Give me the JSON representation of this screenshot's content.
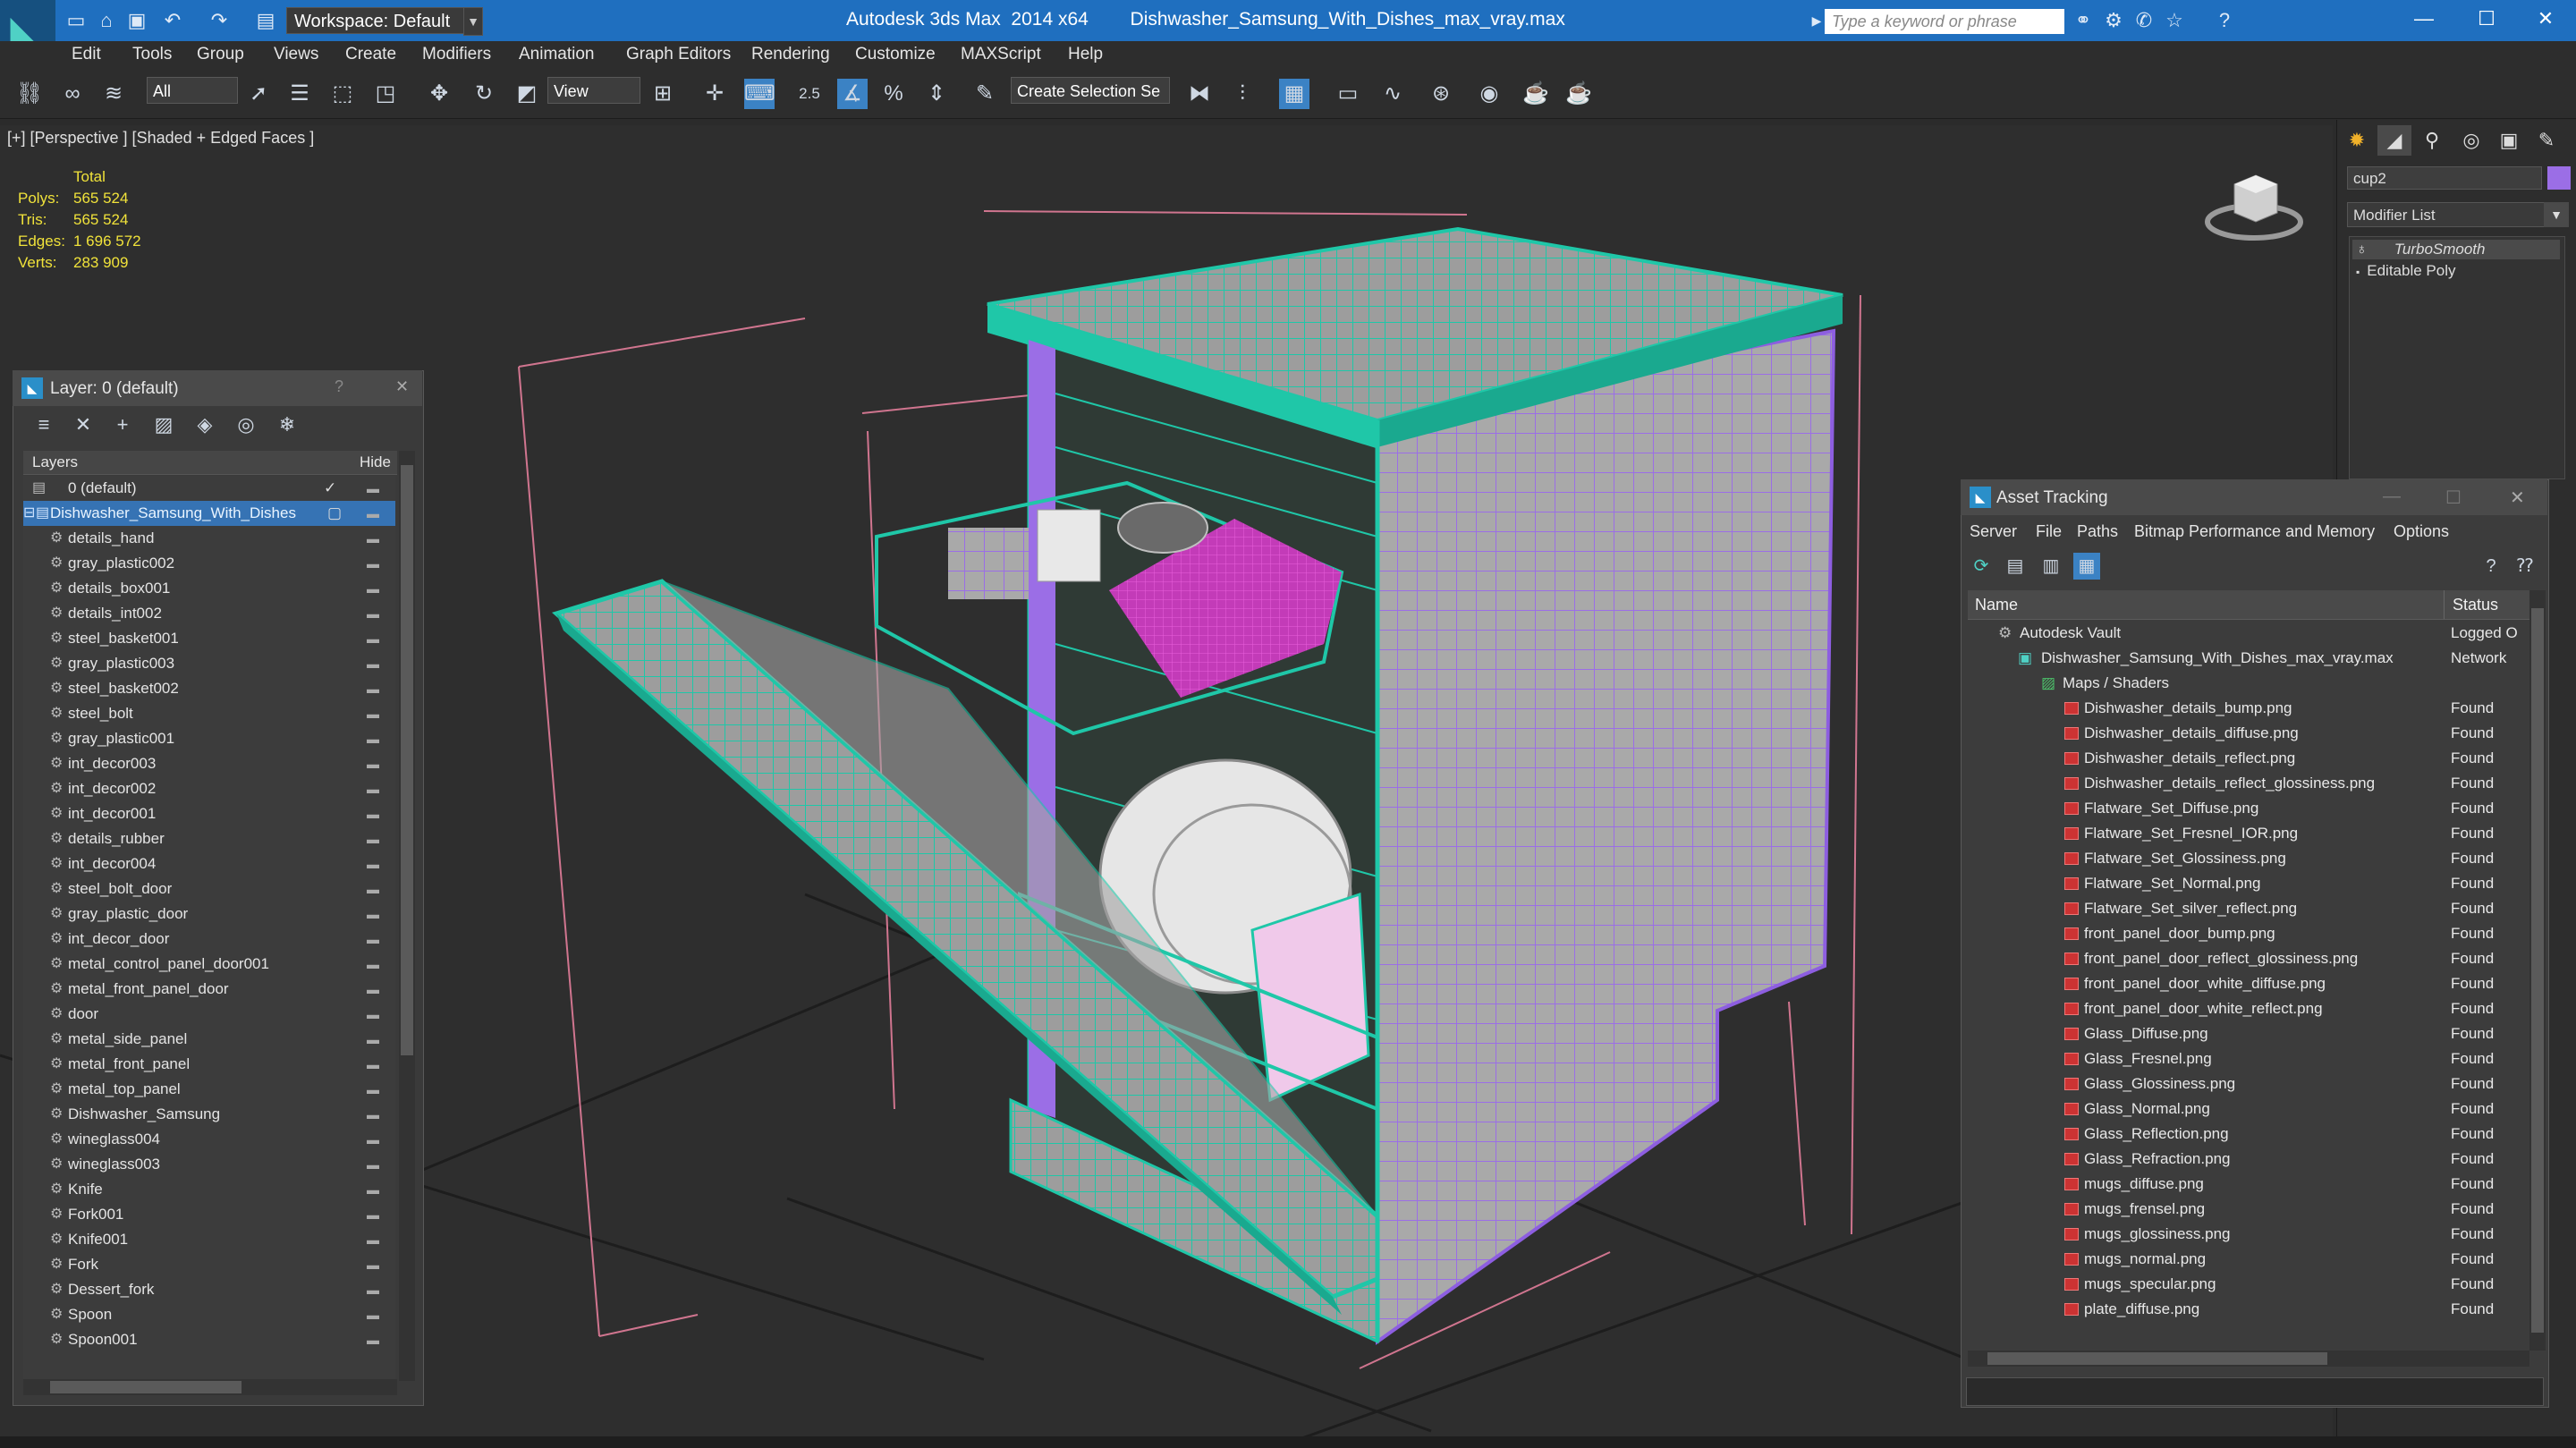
{
  "titlebar": {
    "workspace": "Workspace: Default",
    "app": "Autodesk 3ds Max  2014 x64",
    "file": "Dishwasher_Samsung_With_Dishes_max_vray.max",
    "search_placeholder": "Type a keyword or phrase",
    "minimize": "—",
    "maximize": "☐",
    "close": "✕"
  },
  "menu": [
    "Edit",
    "Tools",
    "Group",
    "Views",
    "Create",
    "Modifiers",
    "Animation",
    "Graph Editors",
    "Rendering",
    "Customize",
    "MAXScript",
    "Help"
  ],
  "toolbar": {
    "filter": "All",
    "refcoord": "View",
    "selset": "Create Selection Se",
    "snap_angle": "2.5"
  },
  "viewport": {
    "label": "[+] [Perspective ] [Shaded + Edged Faces ]",
    "stats": {
      "header": "Total",
      "rows": [
        {
          "label": "Polys:",
          "value": "565 524"
        },
        {
          "label": "Tris:",
          "value": "565 524"
        },
        {
          "label": "Edges:",
          "value": "1 696 572"
        },
        {
          "label": "Verts:",
          "value": "283 909"
        }
      ]
    }
  },
  "command_panel": {
    "object_name": "cup2",
    "modifier_list": "Modifier List",
    "stack": [
      "TurboSmooth",
      "Editable Poly"
    ]
  },
  "layer_panel": {
    "title": "Layer: 0 (default)",
    "help": "?",
    "close": "✕",
    "col_layers": "Layers",
    "col_hide": "Hide",
    "rows": [
      {
        "name": "0 (default)",
        "level": 0,
        "selected": false,
        "check": "✓"
      },
      {
        "name": "Dishwasher_Samsung_With_Dishes",
        "level": 0,
        "selected": true,
        "check": ""
      },
      {
        "name": "details_hand",
        "level": 1
      },
      {
        "name": "gray_plastic002",
        "level": 1
      },
      {
        "name": "details_box001",
        "level": 1
      },
      {
        "name": "details_int002",
        "level": 1
      },
      {
        "name": "steel_basket001",
        "level": 1
      },
      {
        "name": "gray_plastic003",
        "level": 1
      },
      {
        "name": "steel_basket002",
        "level": 1
      },
      {
        "name": "steel_bolt",
        "level": 1
      },
      {
        "name": "gray_plastic001",
        "level": 1
      },
      {
        "name": "int_decor003",
        "level": 1
      },
      {
        "name": "int_decor002",
        "level": 1
      },
      {
        "name": "int_decor001",
        "level": 1
      },
      {
        "name": "details_rubber",
        "level": 1
      },
      {
        "name": "int_decor004",
        "level": 1
      },
      {
        "name": "steel_bolt_door",
        "level": 1
      },
      {
        "name": "gray_plastic_door",
        "level": 1
      },
      {
        "name": "int_decor_door",
        "level": 1
      },
      {
        "name": "metal_control_panel_door001",
        "level": 1
      },
      {
        "name": "metal_front_panel_door",
        "level": 1
      },
      {
        "name": "door",
        "level": 1
      },
      {
        "name": "metal_side_panel",
        "level": 1
      },
      {
        "name": "metal_front_panel",
        "level": 1
      },
      {
        "name": "metal_top_panel",
        "level": 1
      },
      {
        "name": "Dishwasher_Samsung",
        "level": 1
      },
      {
        "name": "wineglass004",
        "level": 1
      },
      {
        "name": "wineglass003",
        "level": 1
      },
      {
        "name": "Knife",
        "level": 1
      },
      {
        "name": "Fork001",
        "level": 1
      },
      {
        "name": "Knife001",
        "level": 1
      },
      {
        "name": "Fork",
        "level": 1
      },
      {
        "name": "Dessert_fork",
        "level": 1
      },
      {
        "name": "Spoon",
        "level": 1
      },
      {
        "name": "Spoon001",
        "level": 1
      }
    ]
  },
  "asset_tracking": {
    "title": "Asset Tracking",
    "menu": [
      "Server",
      "File",
      "Paths",
      "Bitmap Performance and Memory",
      "Options"
    ],
    "col_name": "Name",
    "col_status": "Status",
    "rows": [
      {
        "name": "Autodesk Vault",
        "status": "Logged O",
        "indent": 1,
        "icon": "vault"
      },
      {
        "name": "Dishwasher_Samsung_With_Dishes_max_vray.max",
        "status": "Network",
        "indent": 2,
        "icon": "max"
      },
      {
        "name": "Maps / Shaders",
        "status": "",
        "indent": 3,
        "icon": "maps"
      },
      {
        "name": "Dishwasher_details_bump.png",
        "status": "Found",
        "indent": 4,
        "icon": "png"
      },
      {
        "name": "Dishwasher_details_diffuse.png",
        "status": "Found",
        "indent": 4,
        "icon": "png"
      },
      {
        "name": "Dishwasher_details_reflect.png",
        "status": "Found",
        "indent": 4,
        "icon": "png"
      },
      {
        "name": "Dishwasher_details_reflect_glossiness.png",
        "status": "Found",
        "indent": 4,
        "icon": "png"
      },
      {
        "name": "Flatware_Set_Diffuse.png",
        "status": "Found",
        "indent": 4,
        "icon": "png"
      },
      {
        "name": "Flatware_Set_Fresnel_IOR.png",
        "status": "Found",
        "indent": 4,
        "icon": "png"
      },
      {
        "name": "Flatware_Set_Glossiness.png",
        "status": "Found",
        "indent": 4,
        "icon": "png"
      },
      {
        "name": "Flatware_Set_Normal.png",
        "status": "Found",
        "indent": 4,
        "icon": "png"
      },
      {
        "name": "Flatware_Set_silver_reflect.png",
        "status": "Found",
        "indent": 4,
        "icon": "png"
      },
      {
        "name": "front_panel_door_bump.png",
        "status": "Found",
        "indent": 4,
        "icon": "png"
      },
      {
        "name": "front_panel_door_reflect_glossiness.png",
        "status": "Found",
        "indent": 4,
        "icon": "png"
      },
      {
        "name": "front_panel_door_white_diffuse.png",
        "status": "Found",
        "indent": 4,
        "icon": "png"
      },
      {
        "name": "front_panel_door_white_reflect.png",
        "status": "Found",
        "indent": 4,
        "icon": "png"
      },
      {
        "name": "Glass_Diffuse.png",
        "status": "Found",
        "indent": 4,
        "icon": "png"
      },
      {
        "name": "Glass_Fresnel.png",
        "status": "Found",
        "indent": 4,
        "icon": "png"
      },
      {
        "name": "Glass_Glossiness.png",
        "status": "Found",
        "indent": 4,
        "icon": "png"
      },
      {
        "name": "Glass_Normal.png",
        "status": "Found",
        "indent": 4,
        "icon": "png"
      },
      {
        "name": "Glass_Reflection.png",
        "status": "Found",
        "indent": 4,
        "icon": "png"
      },
      {
        "name": "Glass_Refraction.png",
        "status": "Found",
        "indent": 4,
        "icon": "png"
      },
      {
        "name": "mugs_diffuse.png",
        "status": "Found",
        "indent": 4,
        "icon": "png"
      },
      {
        "name": "mugs_frensel.png",
        "status": "Found",
        "indent": 4,
        "icon": "png"
      },
      {
        "name": "mugs_glossiness.png",
        "status": "Found",
        "indent": 4,
        "icon": "png"
      },
      {
        "name": "mugs_normal.png",
        "status": "Found",
        "indent": 4,
        "icon": "png"
      },
      {
        "name": "mugs_specular.png",
        "status": "Found",
        "indent": 4,
        "icon": "png"
      },
      {
        "name": "plate_diffuse.png",
        "status": "Found",
        "indent": 4,
        "icon": "png"
      }
    ]
  },
  "colors": {
    "titlebar": "#1f6fbf",
    "selection": "#3673b4",
    "stats": "#f0e23a",
    "wire_teal": "#1fc7a8",
    "wire_purple": "#9b6ee6",
    "wire_magenta": "#d61fc0"
  }
}
